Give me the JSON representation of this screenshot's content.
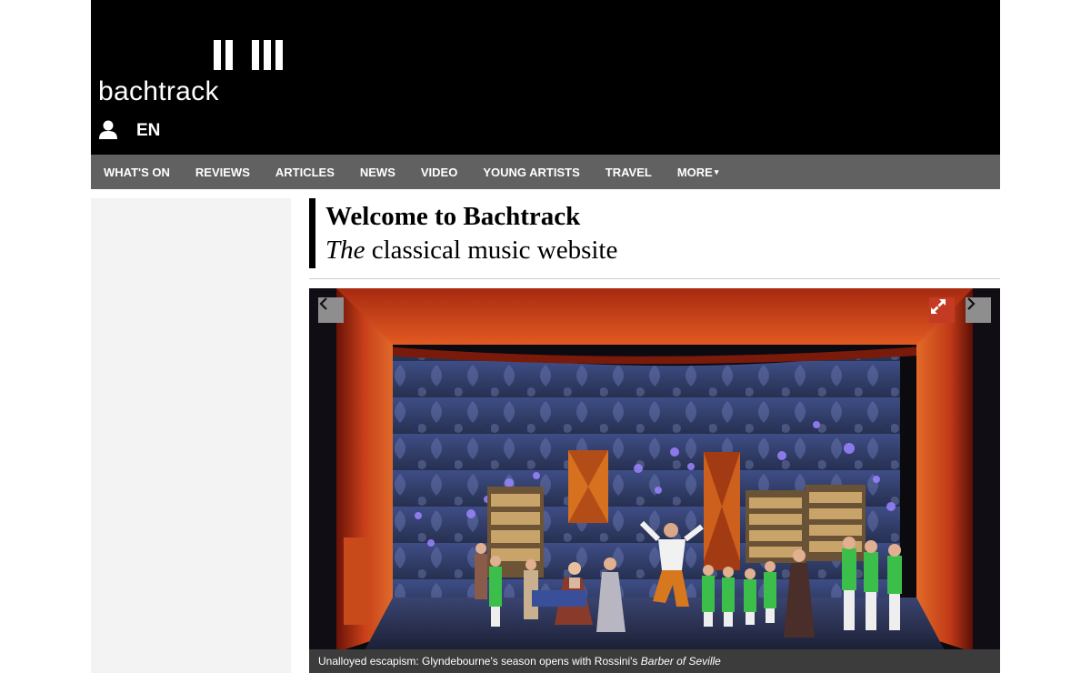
{
  "header": {
    "logo_text": "bachtrack",
    "user_icon": "user-icon",
    "language": "EN"
  },
  "nav": {
    "items": [
      {
        "label": "WHAT'S ON"
      },
      {
        "label": "REVIEWS"
      },
      {
        "label": "ARTICLES"
      },
      {
        "label": "NEWS"
      },
      {
        "label": "VIDEO"
      },
      {
        "label": "YOUNG ARTISTS"
      },
      {
        "label": "TRAVEL"
      },
      {
        "label": "MORE"
      }
    ],
    "more_caret": "▾"
  },
  "welcome": {
    "title": "Welcome to Bachtrack",
    "subtitle_em": "The",
    "subtitle_rest": " classical music website"
  },
  "slideshow": {
    "prev_icon": "chevron-left-icon",
    "next_icon": "chevron-right-icon",
    "expand_icon": "expand-icon",
    "caption_text": "Unalloyed escapism: Glyndebourne's season opens with Rossini's ",
    "caption_em": "Barber of Seville"
  },
  "colors": {
    "header_bg": "#000000",
    "nav_bg": "#616161",
    "left_panel_bg": "#f3f3f3",
    "expand_button": "#c53a22",
    "caption_bg": "#3c3c3c"
  }
}
